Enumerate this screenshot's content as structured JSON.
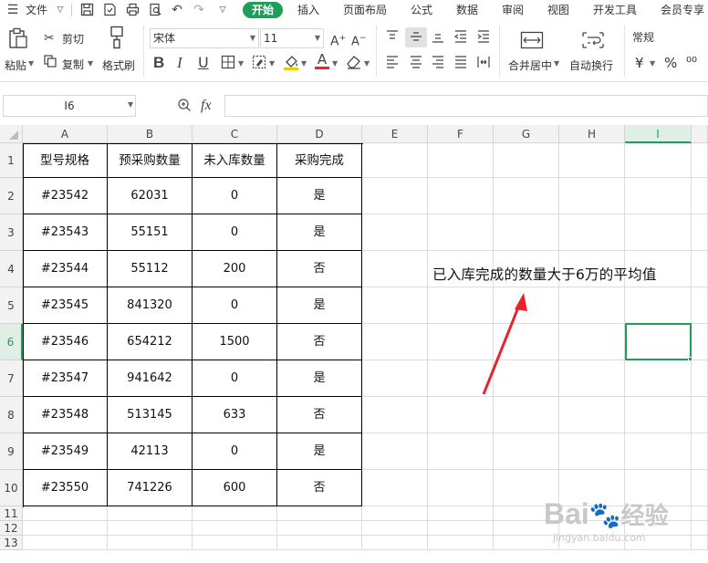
{
  "menubar": {
    "file": "文件",
    "tabs": [
      "开始",
      "插入",
      "页面布局",
      "公式",
      "数据",
      "审阅",
      "视图",
      "开发工具",
      "会员专享"
    ]
  },
  "ribbon": {
    "paste": "粘贴",
    "cut": "剪切",
    "copy": "复制",
    "format_painter": "格式刷",
    "font_name": "宋体",
    "font_size": "11",
    "merge_center": "合并居中",
    "wrap_text": "自动换行",
    "number_format": "常规",
    "currency_symbol": "¥",
    "percent_symbol": "%"
  },
  "formula_bar": {
    "name_box": "I6",
    "fx_label": "fx",
    "value": ""
  },
  "sheet": {
    "columns": [
      "A",
      "B",
      "C",
      "D",
      "E",
      "F",
      "G",
      "H",
      "I"
    ],
    "rows": [
      "1",
      "2",
      "3",
      "4",
      "5",
      "6",
      "7",
      "8",
      "9",
      "10",
      "11",
      "12",
      "13"
    ],
    "active_cell": "I6",
    "table_header": [
      "型号规格",
      "预采购数量",
      "未入库数量",
      "采购完成"
    ],
    "table_rows": [
      [
        "#23542",
        "62031",
        "0",
        "是"
      ],
      [
        "#23543",
        "55151",
        "0",
        "是"
      ],
      [
        "#23544",
        "55112",
        "200",
        "否"
      ],
      [
        "#23545",
        "841320",
        "0",
        "是"
      ],
      [
        "#23546",
        "654212",
        "1500",
        "否"
      ],
      [
        "#23547",
        "941642",
        "0",
        "是"
      ],
      [
        "#23548",
        "513145",
        "633",
        "否"
      ],
      [
        "#23549",
        "42113",
        "0",
        "是"
      ],
      [
        "#23550",
        "741226",
        "600",
        "否"
      ]
    ],
    "annotation": "已入库完成的数量大于6万的平均值"
  },
  "watermark": {
    "brand": "Bai",
    "brand_cn": "经验",
    "url": "jingyan.baidu.com"
  },
  "colors": {
    "accent": "#1e9d5b",
    "arrow": "#e8242a"
  }
}
